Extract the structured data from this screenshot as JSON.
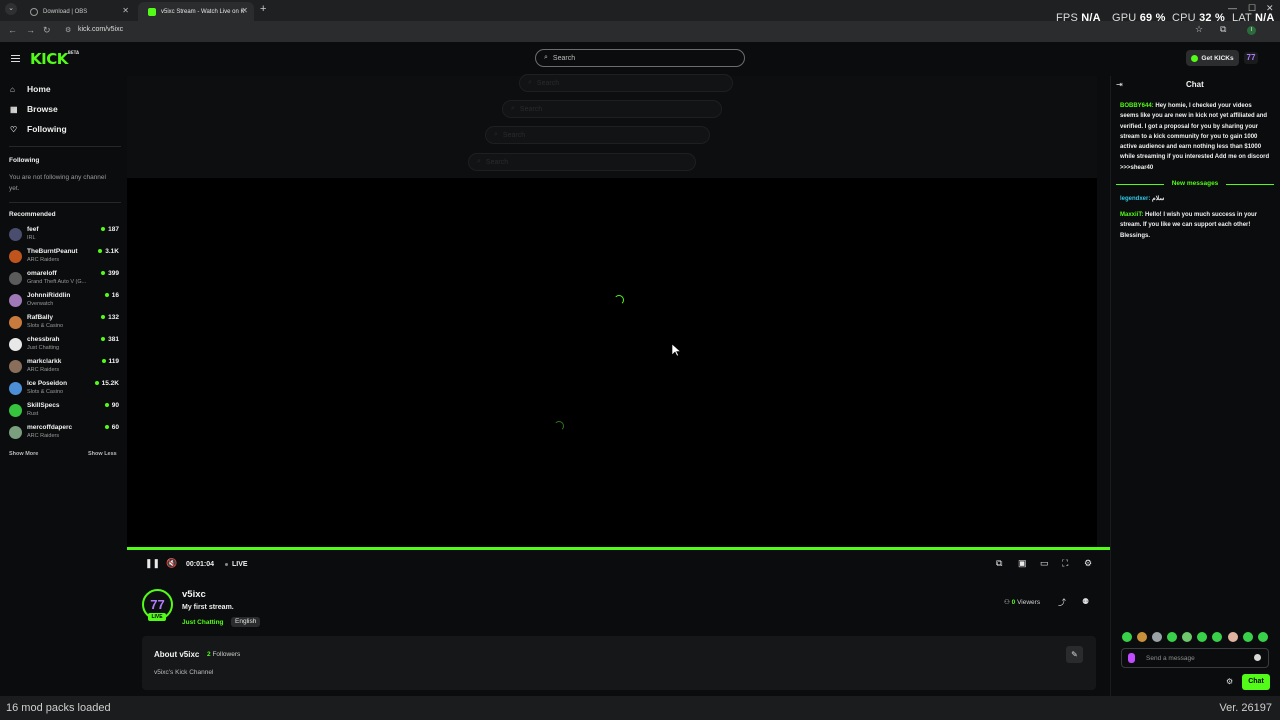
{
  "browser": {
    "tabs": [
      {
        "title": "Download | OBS"
      },
      {
        "title": "v5ixc Stream - Watch Live on K"
      }
    ],
    "url": "kick.com/v5ixc",
    "profile_initial": "I"
  },
  "overlay": {
    "fps_label": "FPS",
    "fps_value": "N/A",
    "gpu_label": "GPU",
    "gpu_value": "69 %",
    "cpu_label": "CPU",
    "cpu_value": "32 %",
    "lat_label": "LAT",
    "lat_value": "N/A"
  },
  "header": {
    "logo": "KICK",
    "logo_badge": "BETA",
    "search_placeholder": "Search",
    "get_kicks": "Get KICKs",
    "user_avatar": "77"
  },
  "sidebar": {
    "nav": [
      {
        "label": "Home",
        "icon": "home-icon"
      },
      {
        "label": "Browse",
        "icon": "browse-icon"
      },
      {
        "label": "Following",
        "icon": "heart-icon"
      }
    ],
    "following_title": "Following",
    "following_empty": "You are not following any channel yet.",
    "recommended_title": "Recommended",
    "recommended": [
      {
        "name": "feef",
        "category": "IRL",
        "viewers": "187",
        "color": "#4a4d6e"
      },
      {
        "name": "TheBurntPeanut",
        "category": "ARC Raiders",
        "viewers": "3.1K",
        "color": "#c0541d"
      },
      {
        "name": "omareloff",
        "category": "Grand Theft Auto V (G...",
        "viewers": "399",
        "color": "#5b5b5b"
      },
      {
        "name": "JohnniRiddlin",
        "category": "Overwatch",
        "viewers": "16",
        "color": "#a07ab8"
      },
      {
        "name": "RafBally",
        "category": "Slots & Casino",
        "viewers": "132",
        "color": "#c97b3d"
      },
      {
        "name": "chessbrah",
        "category": "Just Chatting",
        "viewers": "381",
        "color": "#e8e8e8"
      },
      {
        "name": "markclarkk",
        "category": "ARC Raiders",
        "viewers": "119",
        "color": "#8a6e5c"
      },
      {
        "name": "Ice Poseidon",
        "category": "Slots & Casino",
        "viewers": "15.2K",
        "color": "#4d8fd6"
      },
      {
        "name": "SkillSpecs",
        "category": "Rust",
        "viewers": "90",
        "color": "#36c43f"
      },
      {
        "name": "mercoffdaperc",
        "category": "ARC Raiders",
        "viewers": "60",
        "color": "#7a9e7e"
      }
    ],
    "show_more": "Show More",
    "show_less": "Show Less"
  },
  "player": {
    "time": "00:01:04",
    "live": "LIVE"
  },
  "stream": {
    "channel": "v5ixc",
    "avatar": "77",
    "live_badge": "LIVE",
    "title": "My first stream.",
    "category": "Just Chatting",
    "language": "English",
    "viewers_count": "0",
    "viewers_label": "Viewers"
  },
  "about": {
    "title": "About v5ixc",
    "followers_count": "2",
    "followers_label": "Followers",
    "description": "v5ixc's Kick Channel"
  },
  "chat": {
    "title": "Chat",
    "messages": [
      {
        "user": "BOBBY644:",
        "text": "Hey homie, I checked your videos seems like you are new in kick not yet affiliated and verified. I got a proposal for you by sharing your stream to a kick community for you to gain 1000 active audience and earn nothing less than $1000 while streaming if you interested Add me on discord >>>shear40"
      },
      {
        "user": "legendxer:",
        "text": "سلام"
      },
      {
        "user": "MaxxiiT:",
        "text": "Hello! I wish you much success in your stream. If you like we can support each other! Blessings."
      }
    ],
    "new_messages": "New messages",
    "input_placeholder": "Send a message",
    "send_button": "Chat"
  },
  "status": {
    "left": "16 mod packs loaded",
    "right": "Ver. 26197"
  }
}
